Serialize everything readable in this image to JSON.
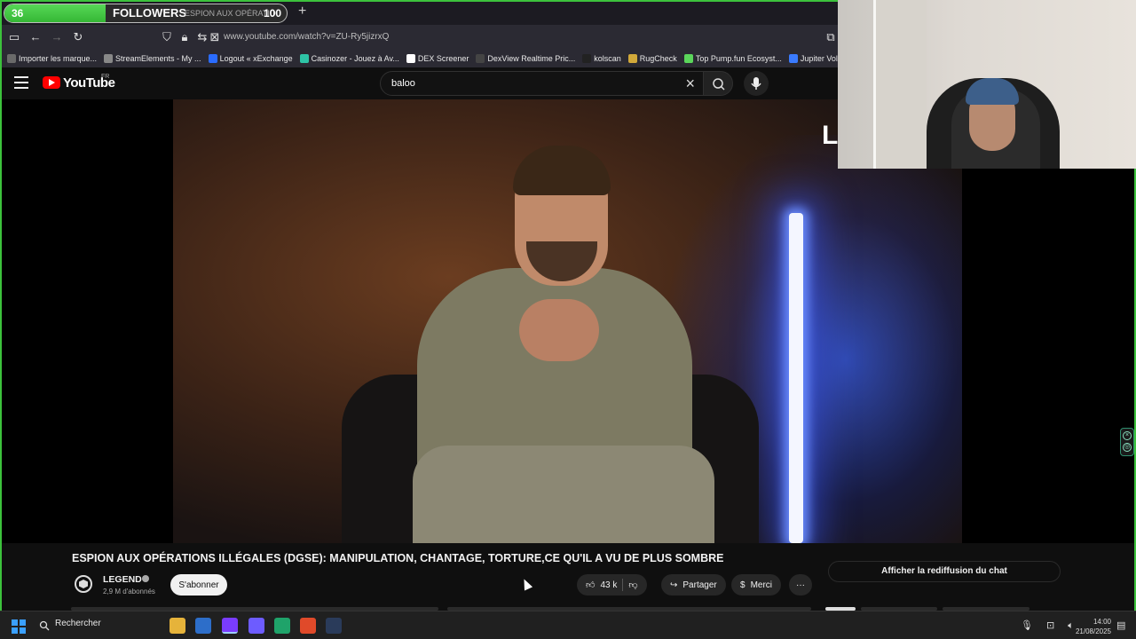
{
  "overlay": {
    "followers_count": "36",
    "followers_label": "FOLLOWERS",
    "followers_goal": "100",
    "followers_progress": 0.36,
    "stream_letter": "L"
  },
  "browser": {
    "tab_title": "ESPION AUX OPÉRATIO",
    "new_tab": "+",
    "url": "www.youtube.com/watch?v=ZU-Ry5jizrxQ",
    "bookmarks": [
      {
        "label": "Importer les marque...",
        "color": "#6a6a6a"
      },
      {
        "label": "StreamElements - My ...",
        "color": "#888888"
      },
      {
        "label": "Logout « xExchange",
        "color": "#2a6cff"
      },
      {
        "label": "Casinozer - Jouez à Av...",
        "color": "#2ec4a6"
      },
      {
        "label": "DEX Screener",
        "color": "#ffffff"
      },
      {
        "label": "DexView Realtime Pric...",
        "color": "#444444"
      },
      {
        "label": "kolscan",
        "color": "#222222"
      },
      {
        "label": "RugCheck",
        "color": "#d2a93a"
      },
      {
        "label": "Top Pump.fun Ecosyst...",
        "color": "#5bd65b"
      },
      {
        "label": "Jupiter Volume - Defil...",
        "color": "#3a7bff"
      },
      {
        "label": "Photo",
        "color": "#7a5cff"
      }
    ]
  },
  "youtube": {
    "logo_text": "YouTube",
    "region": "FR",
    "search_value": "baloo",
    "video_title": "ESPION AUX OPÉRATIONS ILLÉGALES (DGSE): MANIPULATION, CHANTAGE, TORTURE,CE QU'IL A VU DE PLUS SOMBRE",
    "channel_name": "LEGEND",
    "channel_subs": "2,9 M d'abonnés",
    "subscribe_label": "S'abonner",
    "likes": "43 k",
    "share_label": "Partager",
    "thanks_label": "Merci",
    "more_label": "···",
    "chat_replay_label": "Afficher la rediffusion du chat"
  },
  "taskbar": {
    "search_label": "Rechercher",
    "time": "14:00",
    "date": "21/08/2025"
  },
  "colors": {
    "frame": "#3cc23c",
    "progress": "#35b735",
    "youtube_red": "#ff0000",
    "windows_blue": "#3aa0ff"
  }
}
